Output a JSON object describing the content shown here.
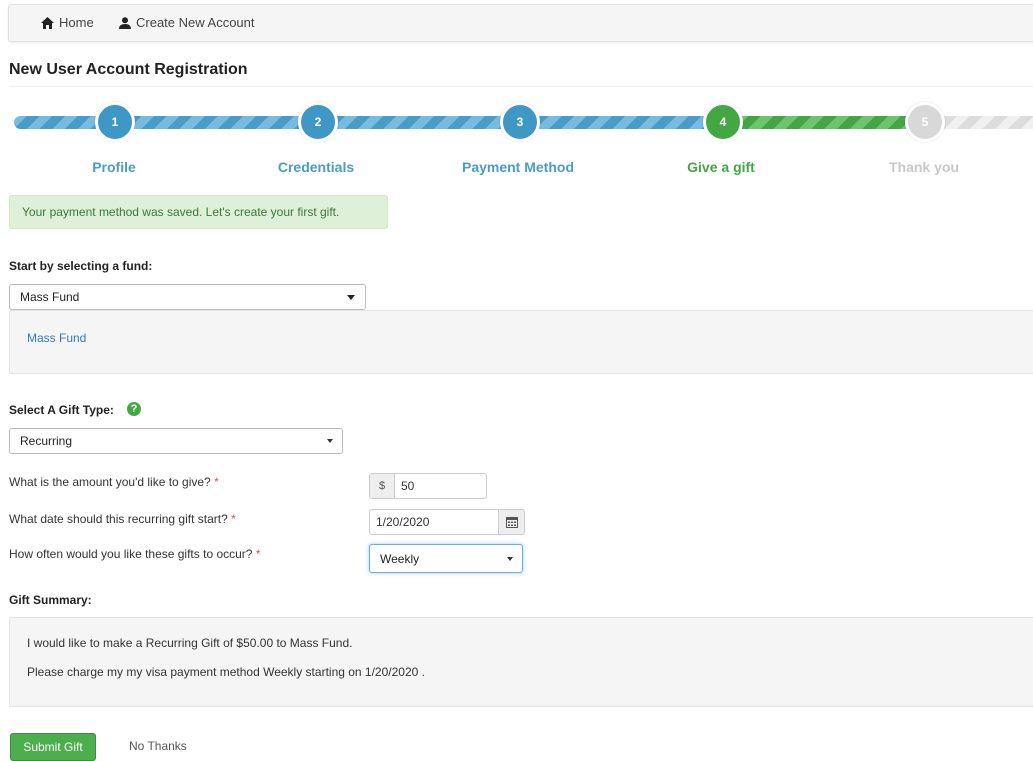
{
  "breadcrumb": {
    "home": "Home",
    "create": "Create New Account"
  },
  "page": {
    "title": "New User Account Registration"
  },
  "wizard": {
    "steps": [
      {
        "num": "1",
        "label": "Profile",
        "state": "complete"
      },
      {
        "num": "2",
        "label": "Credentials",
        "state": "complete"
      },
      {
        "num": "3",
        "label": "Payment Method",
        "state": "complete"
      },
      {
        "num": "4",
        "label": "Give a gift",
        "state": "active"
      },
      {
        "num": "5",
        "label": "Thank you",
        "state": "pending"
      }
    ]
  },
  "alert": {
    "message": "Your payment method was saved. Let's create your first gift."
  },
  "fund": {
    "label": "Start by selecting a fund:",
    "selected": "Mass Fund",
    "link": "Mass Fund"
  },
  "gift_type": {
    "label": "Select A Gift Type:",
    "help": "?",
    "selected": "Recurring"
  },
  "amount": {
    "label": "What is the amount you'd like to give?",
    "required": "*",
    "prefix": "$",
    "value": "50"
  },
  "start_date": {
    "label": "What date should this recurring gift start?",
    "required": "*",
    "value": "1/20/2020"
  },
  "frequency": {
    "label": "How often would you like these gifts to occur?",
    "required": "*",
    "selected": "Weekly"
  },
  "summary": {
    "label": "Gift Summary:",
    "line1": "I would like to make a Recurring Gift of $50.00 to Mass Fund.",
    "line2": "Please charge my my visa payment method Weekly starting on 1/20/2020 ."
  },
  "actions": {
    "submit": "Submit Gift",
    "no_thanks": "No Thanks"
  },
  "colors": {
    "primary_blue": "#3f97c6",
    "success_green": "#43a843",
    "inactive_grey": "#d8d8d8",
    "alert_bg": "#dff0d8"
  }
}
